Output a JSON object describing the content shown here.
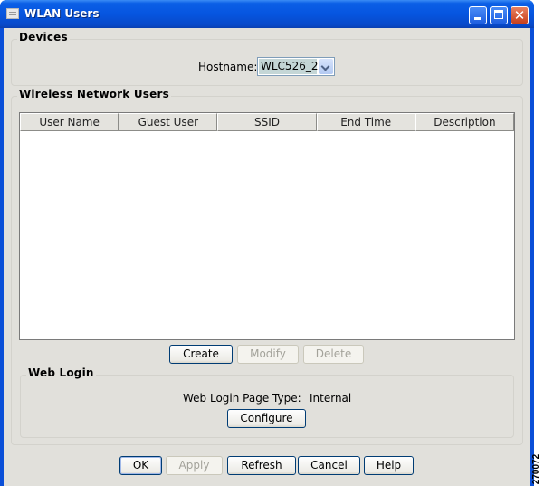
{
  "window": {
    "title": "WLAN Users",
    "controls": {
      "minimize": "minimize",
      "maximize": "maximize",
      "close": "✕"
    }
  },
  "devices": {
    "group_title": "Devices",
    "hostname_label": "Hostname:",
    "hostname_value": "WLC526_2"
  },
  "wireless_users": {
    "group_title": "Wireless Network Users",
    "columns": [
      "User Name",
      "Guest User",
      "SSID",
      "End Time",
      "Description"
    ],
    "rows": [],
    "buttons": {
      "create": "Create",
      "modify": "Modify",
      "delete": "Delete"
    }
  },
  "web_login": {
    "group_title": "Web Login",
    "page_type_label": "Web Login Page Type:",
    "page_type_value": "Internal",
    "configure": "Configure"
  },
  "footer": {
    "ok": "OK",
    "apply": "Apply",
    "refresh": "Refresh",
    "cancel": "Cancel",
    "help": "Help"
  },
  "figure_id": "270072"
}
